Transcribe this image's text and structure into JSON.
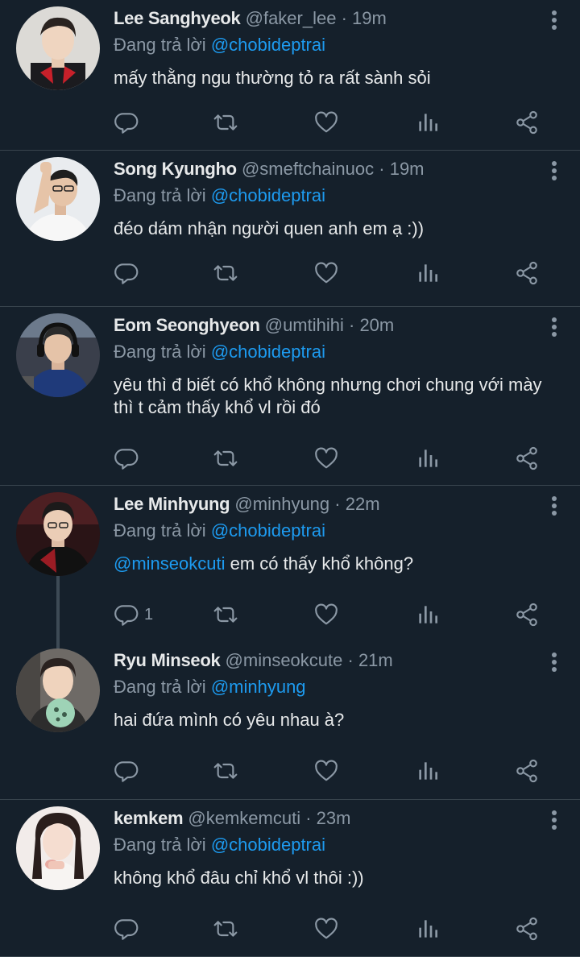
{
  "tweets": [
    {
      "name": "Lee Sanghyeok",
      "handle": "@faker_lee",
      "time": "· 19m",
      "reply_prefix": "Đang trả lời ",
      "reply_to": "@chobideptrai",
      "mention": "",
      "text": "mấy thằng ngu thường tỏ ra rất sành sỏi",
      "reply_count": ""
    },
    {
      "name": "Song Kyungho",
      "handle": "@smeftchainuoc",
      "time": "· 19m",
      "reply_prefix": "Đang trả lời ",
      "reply_to": "@chobideptrai",
      "mention": "",
      "text": "đéo dám nhận người quen anh em ạ :))",
      "reply_count": ""
    },
    {
      "name": "Eom Seonghyeon",
      "handle": "@umtihihi",
      "time": "· 20m",
      "reply_prefix": "Đang trả lời ",
      "reply_to": "@chobideptrai",
      "mention": "",
      "text": "yêu thì đ biết có khổ không nhưng chơi chung với mày thì t cảm thấy khổ vl rồi đó",
      "reply_count": ""
    },
    {
      "name": "Lee Minhyung",
      "handle": "@minhyung",
      "time": "· 22m",
      "reply_prefix": "Đang trả lời ",
      "reply_to": "@chobideptrai",
      "mention": "@minseokcuti",
      "text": " em có thấy khổ không?",
      "reply_count": "1"
    },
    {
      "name": "Ryu Minseok",
      "handle": "@minseokcute",
      "time": "· 21m",
      "reply_prefix": "Đang trả lời ",
      "reply_to": "@minhyung",
      "mention": "",
      "text": "hai đứa mình có yêu nhau à?",
      "reply_count": ""
    },
    {
      "name": "kemkem",
      "handle": "@kemkemcuti",
      "time": "· 23m",
      "reply_prefix": "Đang trả lời ",
      "reply_to": "@chobideptrai",
      "mention": "",
      "text": "không khổ đâu chỉ khổ vl thôi :))",
      "reply_count": ""
    }
  ],
  "icons": {
    "reply": "reply-icon",
    "retweet": "retweet-icon",
    "like": "heart-icon",
    "views": "views-icon",
    "share": "share-icon",
    "more": "more-icon"
  },
  "colors": {
    "background": "#15202b",
    "accent": "#1d9bf0",
    "secondary_text": "#8b98a5",
    "divider": "#38444d"
  }
}
